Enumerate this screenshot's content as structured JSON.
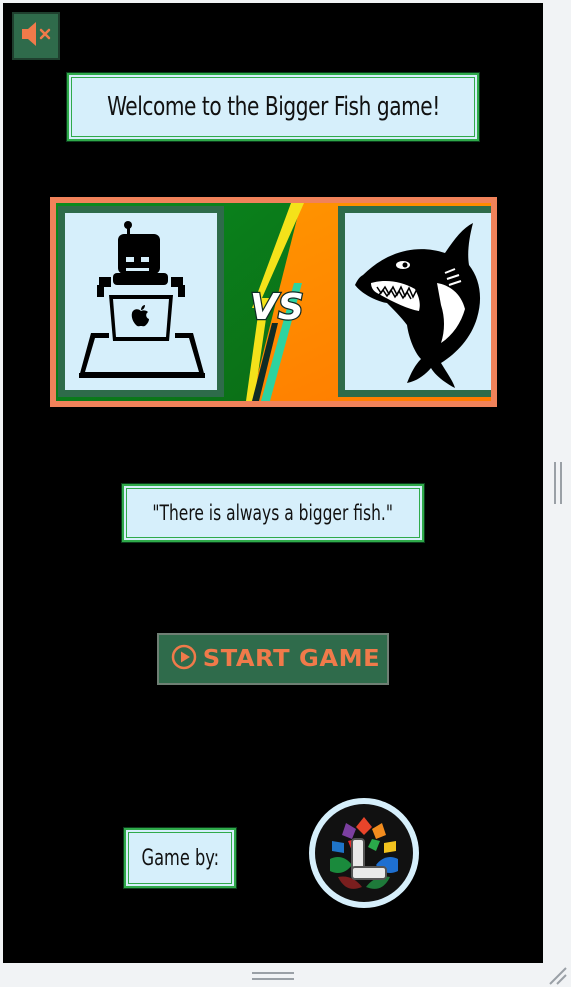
{
  "game": {
    "title": "Welcome to the Bigger Fish game!",
    "quote": "\"There is always a bigger fish.\"",
    "credit_label": "Game by:",
    "start_label": "START GAME",
    "vs_text": "VS"
  },
  "icons": {
    "mute": "speaker-muted-icon",
    "play": "play-circle-icon",
    "robot": "robot-laptop-icon",
    "shark": "shark-icon",
    "logo": "developer-logo"
  },
  "colors": {
    "background": "#000000",
    "button_green": "#2f6b4b",
    "accent_orange": "#f07a4a",
    "box_fill": "#d6effb",
    "box_border": "#2faa4a"
  }
}
